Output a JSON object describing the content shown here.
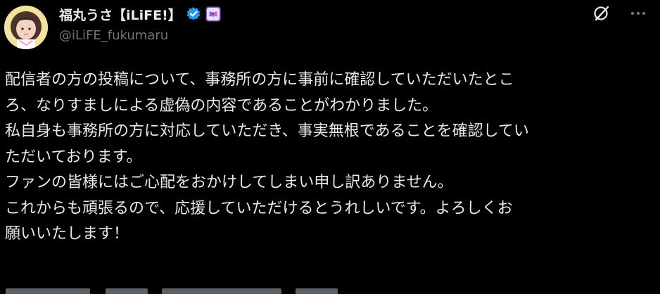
{
  "author": {
    "display_name": "福丸うさ【iLiFE!】",
    "handle": "@iLiFE_fukumaru",
    "verified": true,
    "verified_icon": "verified-badge-icon",
    "affiliate_icon": "affiliate-badge-icon",
    "avatar_icon": "avatar-photo"
  },
  "actions": {
    "grok_icon": "grok-icon",
    "more_icon": "more-dots-icon"
  },
  "tweet": {
    "lines": [
      "配信者の方の投稿について、事務所の方に事前に確認していただいたとこ",
      "ろ、なりすましによる虚偽の内容であることがわかりました。",
      "私自身も事務所の方に対応していただき、事実無根であることを確認してい",
      "ただいております。",
      "ファンの皆様にはご心配をおかけしてしまい申し訳ありません。",
      "これからも頑張るので、応援していただけるとうれしいです。よろしくお",
      "願いいたします！"
    ]
  },
  "colors": {
    "background": "#000000",
    "text_primary": "#e7e9ea",
    "text_secondary": "#71767b",
    "verified_blue": "#1d9bf0",
    "affiliate_purple": "#7e57c2"
  }
}
